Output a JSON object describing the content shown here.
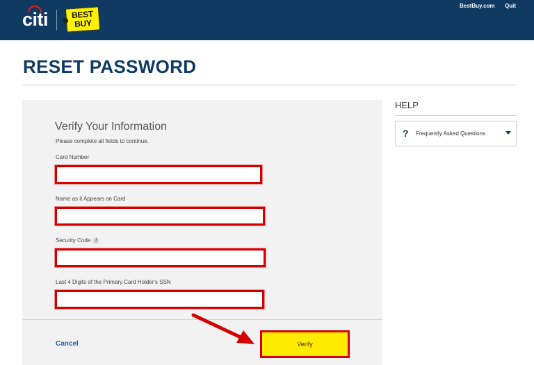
{
  "header": {
    "citi_logo_text": "citi",
    "bestbuy_logo_line1": "BEST",
    "bestbuy_logo_line2": "BUY",
    "links": [
      "BestBuy.com",
      "Quit"
    ]
  },
  "page": {
    "title": "RESET PASSWORD"
  },
  "form": {
    "title": "Verify Your Information",
    "subtitle": "Please complete all fields to continue.",
    "fields": [
      {
        "label": "Card Number",
        "value": ""
      },
      {
        "label": "Name as it Appears on Card",
        "value": ""
      },
      {
        "label": "Security Code",
        "value": "",
        "info_icon": "i"
      },
      {
        "label": "Last 4 Digits of the Primary Card Holder's SSN",
        "value": ""
      }
    ],
    "cancel_label": "Cancel",
    "verify_label": "Verify"
  },
  "help": {
    "title": "HELP",
    "faq_icon": "?",
    "faq_label": "Frequently Asked Questions"
  },
  "colors": {
    "header_bg": "#0f3a62",
    "title": "#0f3a62",
    "highlight_border": "#d40000",
    "verify_bg": "#ffea00",
    "link": "#1f5fa8"
  }
}
